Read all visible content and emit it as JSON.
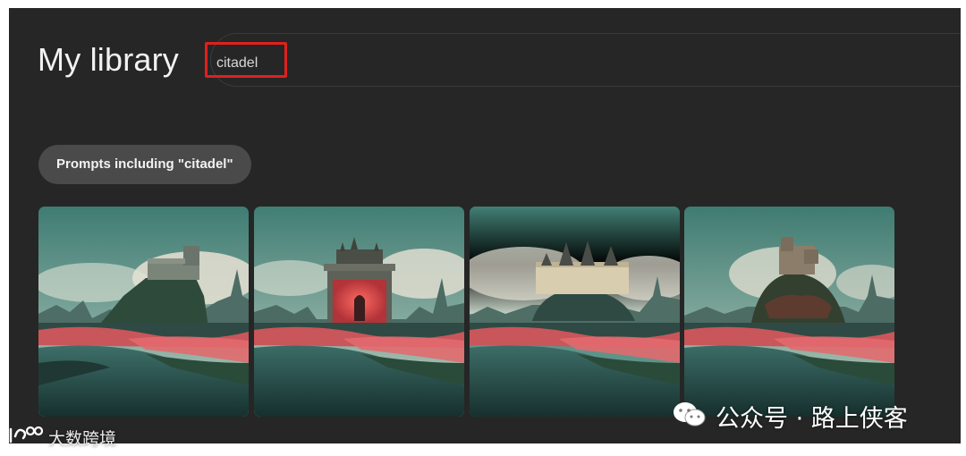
{
  "header": {
    "title": "My library"
  },
  "search": {
    "value": "citadel"
  },
  "filter": {
    "chip_label": "Prompts including \"citadel\""
  },
  "images": [
    {
      "subject": "castle-on-rocky-hill"
    },
    {
      "subject": "castle-with-red-glowing-gate"
    },
    {
      "subject": "pale-castle-with-spires"
    },
    {
      "subject": "castle-on-dark-hill"
    }
  ],
  "watermarks": {
    "right_text": "公众号 · 路上侠客",
    "right_icon": "wechat-icon",
    "left_text": "大数跨境",
    "left_icon": "logo-icon"
  },
  "colors": {
    "background": "#262626",
    "highlight": "#e0201c",
    "chip": "#4a4a4a"
  }
}
